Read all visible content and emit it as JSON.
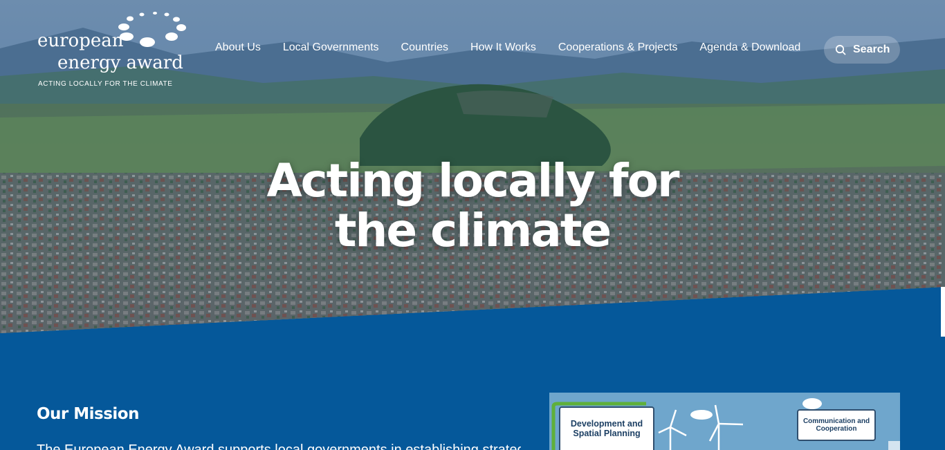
{
  "logo": {
    "line1": "european",
    "line2": "energy award",
    "tagline": "ACTING LOCALLY FOR THE CLIMATE"
  },
  "nav": {
    "items": [
      "About Us",
      "Local Governments",
      "Countries",
      "How It Works",
      "Cooperations & Projects",
      "Agenda & Download"
    ]
  },
  "search": {
    "label": "Search",
    "icon": "search-icon"
  },
  "hero": {
    "title_line1": "Acting locally for",
    "title_line2": "the climate"
  },
  "mission": {
    "title": "Our Mission",
    "text": "The European Energy Award supports local governments in establishing strategic"
  },
  "infographic": {
    "box1": "Development and Spatial Planning",
    "box2": "Communication and Cooperation"
  },
  "colors": {
    "brand_blue": "#05589a",
    "infographic_bg": "#6fa6cc"
  }
}
